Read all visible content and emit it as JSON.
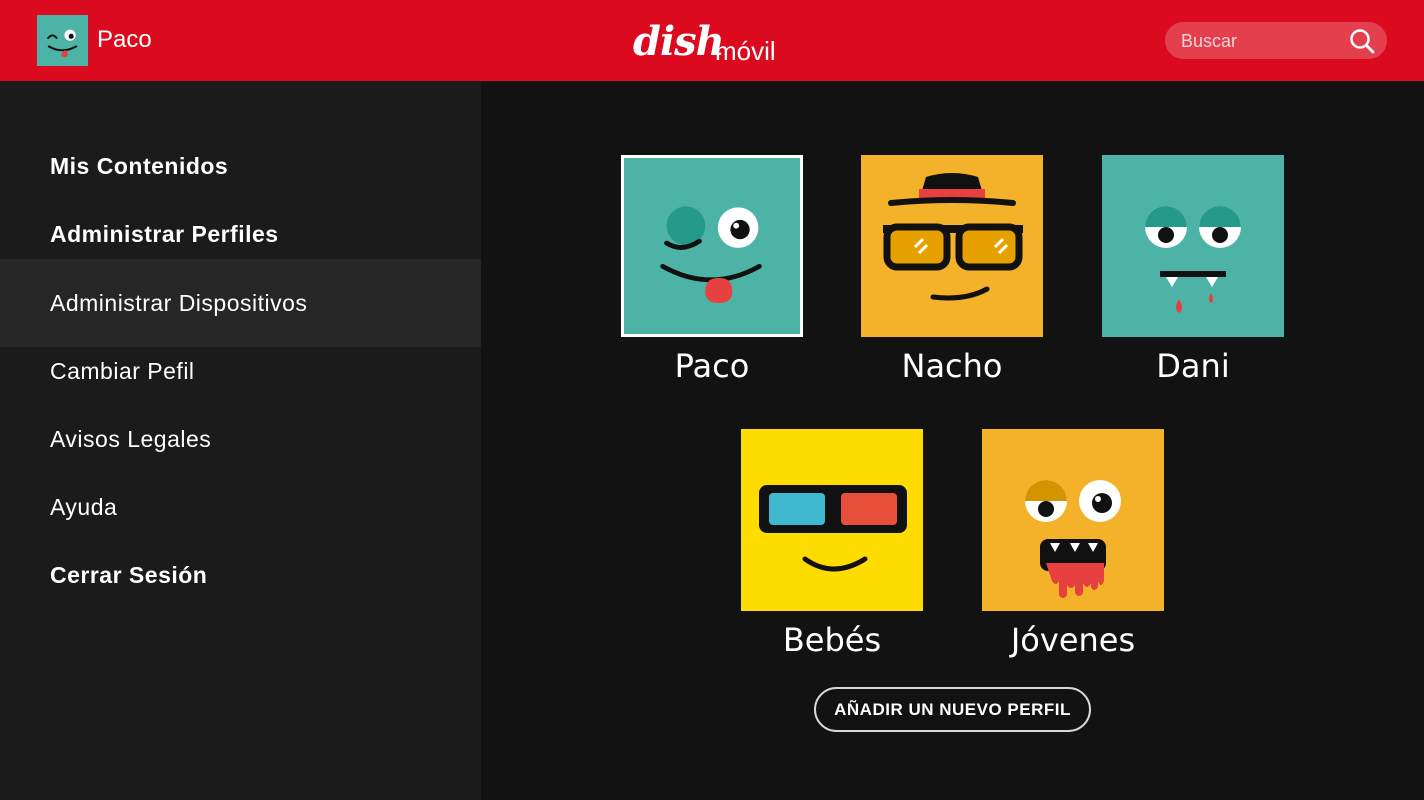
{
  "header": {
    "user_name": "Paco",
    "logo_text_1": "dish",
    "logo_text_2": "móvil",
    "search_placeholder": "Buscar"
  },
  "sidebar": {
    "items": [
      {
        "label": "Mis Contenidos"
      },
      {
        "label": "Administrar Perfiles"
      },
      {
        "label": "Administrar Dispositivos"
      },
      {
        "label": "Cambiar Pefil"
      },
      {
        "label": "Avisos Legales"
      },
      {
        "label": "Ayuda"
      },
      {
        "label": "Cerrar Sesión"
      }
    ]
  },
  "profiles": [
    {
      "name": "Paco",
      "color": "#4db3a6"
    },
    {
      "name": "Nacho",
      "color": "#f4b12a"
    },
    {
      "name": "Dani",
      "color": "#4db3a6"
    },
    {
      "name": "Bebés",
      "color": "#fedc00"
    },
    {
      "name": "Jóvenes",
      "color": "#f4b12a"
    }
  ],
  "add_profile_label": "AÑADIR UN NUEVO PERFIL",
  "colors": {
    "header": "#dc0a1e",
    "sidebar": "#1b1b1b",
    "sidebar_active": "#262626",
    "background": "#121212"
  },
  "icons": [
    "search-icon",
    "paco-face-icon",
    "nacho-face-icon",
    "dani-face-icon",
    "bebes-face-icon",
    "jovenes-face-icon"
  ]
}
